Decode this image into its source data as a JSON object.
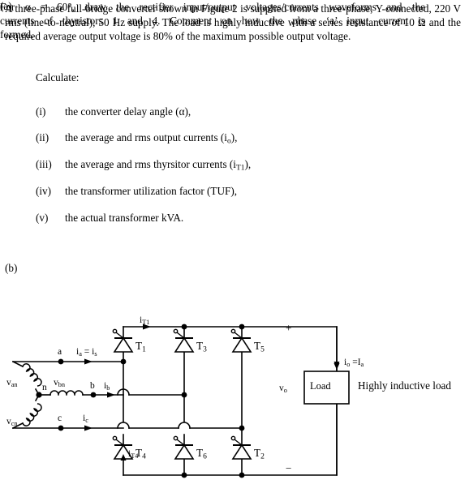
{
  "document": {
    "intro": "A three-phase full-bridge converter shown in Figure 2 is supplied from a three-phase, Y-connected, 220 V rms (line-to-neutral), 50 Hz supply.  The load is highly inductive with a series resistance of 10 Ω and the required average output voltage is 80% of the maximum possible output voltage.",
    "parts": [
      {
        "label": "(a)",
        "text": "Calculate:",
        "items": [
          {
            "num": "(i)",
            "text_pre": "the converter delay angle (α),",
            "text": "the converter delay angle (α),"
          },
          {
            "num": "(ii)",
            "text": "the average and rms  output currents (i",
            "sub": "o",
            "text_post": "),"
          },
          {
            "num": "(iii)",
            "text": "the average and rms thyrsitor currents (i",
            "sub": "T1",
            "text_post": "),"
          },
          {
            "num": "(iv)",
            "text": "the transformer utilization factor (TUF),",
            "sub": "",
            "text_post": ""
          },
          {
            "num": "(v)",
            "text": "the actual transformer kVA.",
            "sub": "",
            "text_post": ""
          }
        ]
      },
      {
        "label": "(b)",
        "line1": "For α = 60°, draw the rectifier input/output voltages/currents waveforms and the",
        "line2": "currents of thyristors 1 and 4.   Comment on how the phase ‘a’ input current is",
        "line3": "formed."
      }
    ]
  },
  "circuit": {
    "figure_name": "three-phase-full-bridge-converter",
    "source_labels": {
      "van": "v",
      "van_sub": "an",
      "vbn": "v",
      "vbn_sub": "bn",
      "vcn": "v",
      "vcn_sub": "cn",
      "neutral": "n",
      "phase_a": "a",
      "phase_b": "b",
      "phase_c": "c"
    },
    "current_labels": {
      "ia": "i",
      "ia_sub": "a",
      "ia_eq": " = i",
      "ia_eq_sub": "s",
      "ib": "i",
      "ib_sub": "b",
      "ic": "i",
      "ic_sub": "c",
      "it1": "i",
      "it1_sub": "T1",
      "it4": "i",
      "it4_sub": "T4",
      "io": "i",
      "io_sub": "o",
      "io_eq": " =I",
      "io_eq_sub": "a"
    },
    "thyristors": [
      {
        "name": "T",
        "sub": "1"
      },
      {
        "name": "T",
        "sub": "3"
      },
      {
        "name": "T",
        "sub": "5"
      },
      {
        "name": "T",
        "sub": "4"
      },
      {
        "name": "T",
        "sub": "6"
      },
      {
        "name": "T",
        "sub": "2"
      }
    ],
    "output": {
      "plus": "+",
      "minus": "−",
      "vo": "v",
      "vo_sub": "o",
      "load_box": "Load",
      "load_caption": "Highly inductive load"
    },
    "colors": {
      "wire": "#000000",
      "background": "#ffffff",
      "text": "#000000"
    }
  }
}
